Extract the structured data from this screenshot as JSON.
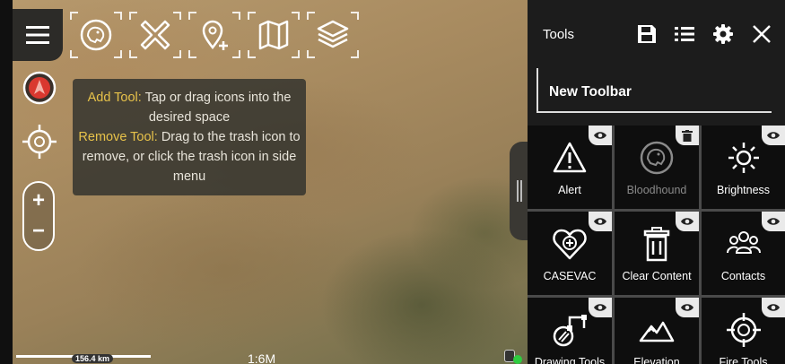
{
  "map": {
    "toolbar": {
      "menu_icon": "hamburger-menu-icon",
      "slots": [
        {
          "icon": "bloodhound-icon"
        },
        {
          "icon": "cross-arrows-icon"
        },
        {
          "icon": "add-point-icon"
        },
        {
          "icon": "map-icon"
        },
        {
          "icon": "layers-icon"
        }
      ]
    },
    "instructions": {
      "add_label": "Add Tool:",
      "add_text": " Tap or drag icons into the desired space",
      "remove_label": "Remove Tool:",
      "remove_text": " Drag to the trash icon to remove, or click the trash icon in side menu"
    },
    "zoom_in_label": "+",
    "zoom_out_label": "−",
    "scale_label": "156.4 km",
    "zoom_level": "1:6M"
  },
  "panel": {
    "title": "Tools",
    "header_icons": [
      "save-icon",
      "list-icon",
      "gear-icon",
      "close-icon"
    ],
    "toolbar_name": "New Toolbar",
    "tools": [
      {
        "label": "Alert",
        "icon": "alert-icon",
        "badge": "eye-icon",
        "enabled": true
      },
      {
        "label": "Bloodhound",
        "icon": "bloodhound-icon",
        "badge": "trash-icon",
        "enabled": false
      },
      {
        "label": "Brightness",
        "icon": "brightness-icon",
        "badge": "eye-icon",
        "enabled": true
      },
      {
        "label": "CASEVAC",
        "icon": "casevac-icon",
        "badge": "eye-icon",
        "enabled": true
      },
      {
        "label": "Clear Content",
        "icon": "clear-content-icon",
        "badge": "eye-icon",
        "enabled": true
      },
      {
        "label": "Contacts",
        "icon": "contacts-icon",
        "badge": "eye-icon",
        "enabled": true
      },
      {
        "label": "Drawing Tools",
        "icon": "drawing-tools-icon",
        "badge": "eye-icon",
        "enabled": true
      },
      {
        "label": "Elevation",
        "icon": "elevation-icon",
        "badge": "eye-icon",
        "enabled": true
      },
      {
        "label": "Fire Tools",
        "icon": "fire-tools-icon",
        "badge": "eye-icon",
        "enabled": true
      }
    ]
  },
  "colors": {
    "highlight": "#e7c24a",
    "panel_bg": "#1c1c1c",
    "compass_red": "#d9382f",
    "status_green": "#2ecc40"
  }
}
